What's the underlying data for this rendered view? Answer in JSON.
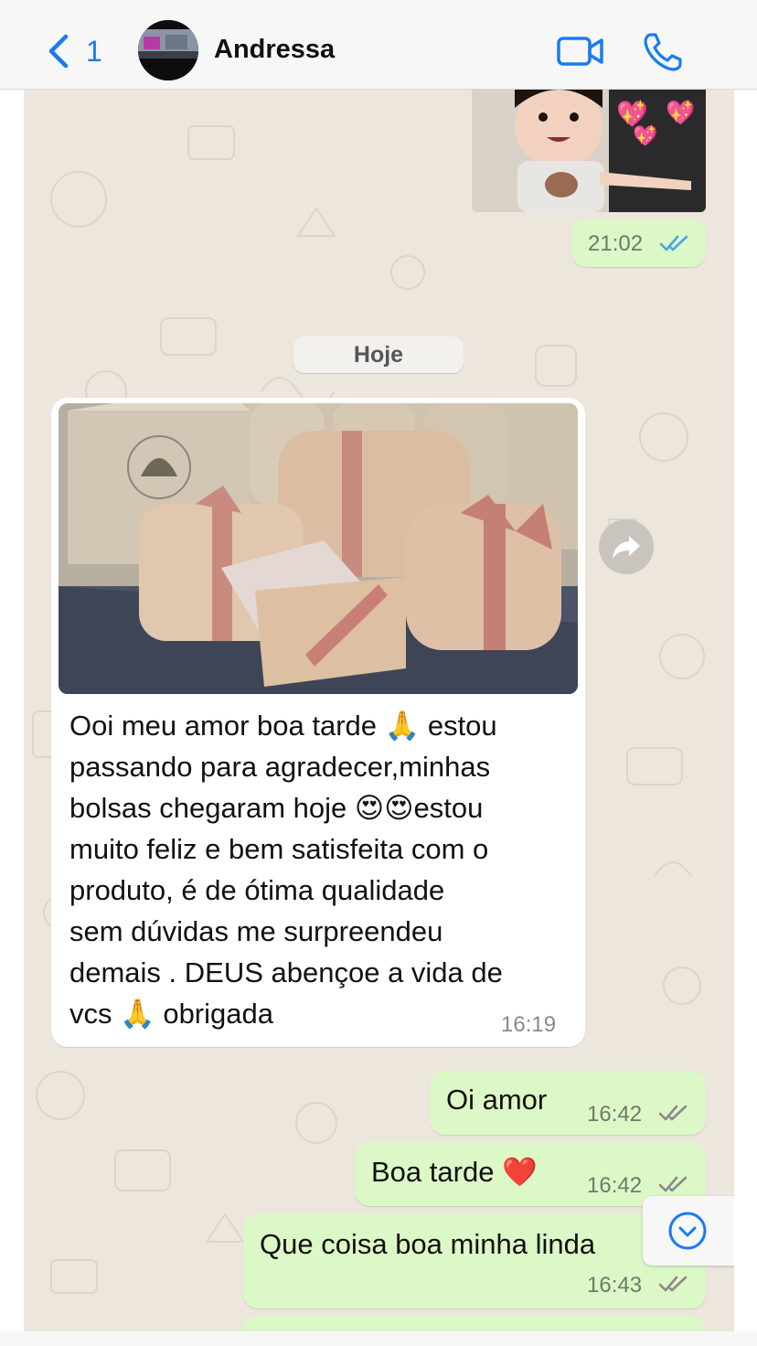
{
  "header": {
    "back_count": "1",
    "contact_name": "Andressa"
  },
  "chat": {
    "messages": [
      {
        "direction": "out",
        "type": "image",
        "time": "21:02",
        "status": "read"
      },
      {
        "type": "date-separator",
        "label": "Hoje"
      },
      {
        "direction": "in",
        "type": "image-with-caption",
        "text": "Ooi meu amor boa tarde 🙏 estou\npassando para agradecer,minhas\nbolsas chegaram hoje 😍😍estou\nmuito feliz e bem satisfeita com o\nproduto, é de ótima qualidade\nsem dúvidas me surpreendeu\ndemais . DEUS abençoe a vida de\nvcs 🙏 obrigada",
        "time": "16:19"
      },
      {
        "direction": "out",
        "type": "text",
        "text": "Oi amor",
        "time": "16:42",
        "status": "delivered"
      },
      {
        "direction": "out",
        "type": "text",
        "text": "Boa tarde ❤️",
        "time": "16:42",
        "status": "delivered"
      },
      {
        "direction": "out",
        "type": "text",
        "text": "Que coisa boa minha linda",
        "time": "16:43",
        "status": "delivered"
      }
    ]
  },
  "colors": {
    "accent": "#1a7bf2",
    "outgoing_bubble": "#dcf8c6",
    "incoming_bubble": "#ffffff",
    "chat_background": "#ece6dd",
    "read_tick": "#4fa3e8",
    "delivered_tick": "#8a8a8a"
  },
  "icons": {
    "back": "chevron-left-icon",
    "video_call": "video-camera-icon",
    "voice_call": "phone-icon",
    "forward": "forward-arrow-icon",
    "scroll_down": "chevron-down-circle-icon"
  }
}
